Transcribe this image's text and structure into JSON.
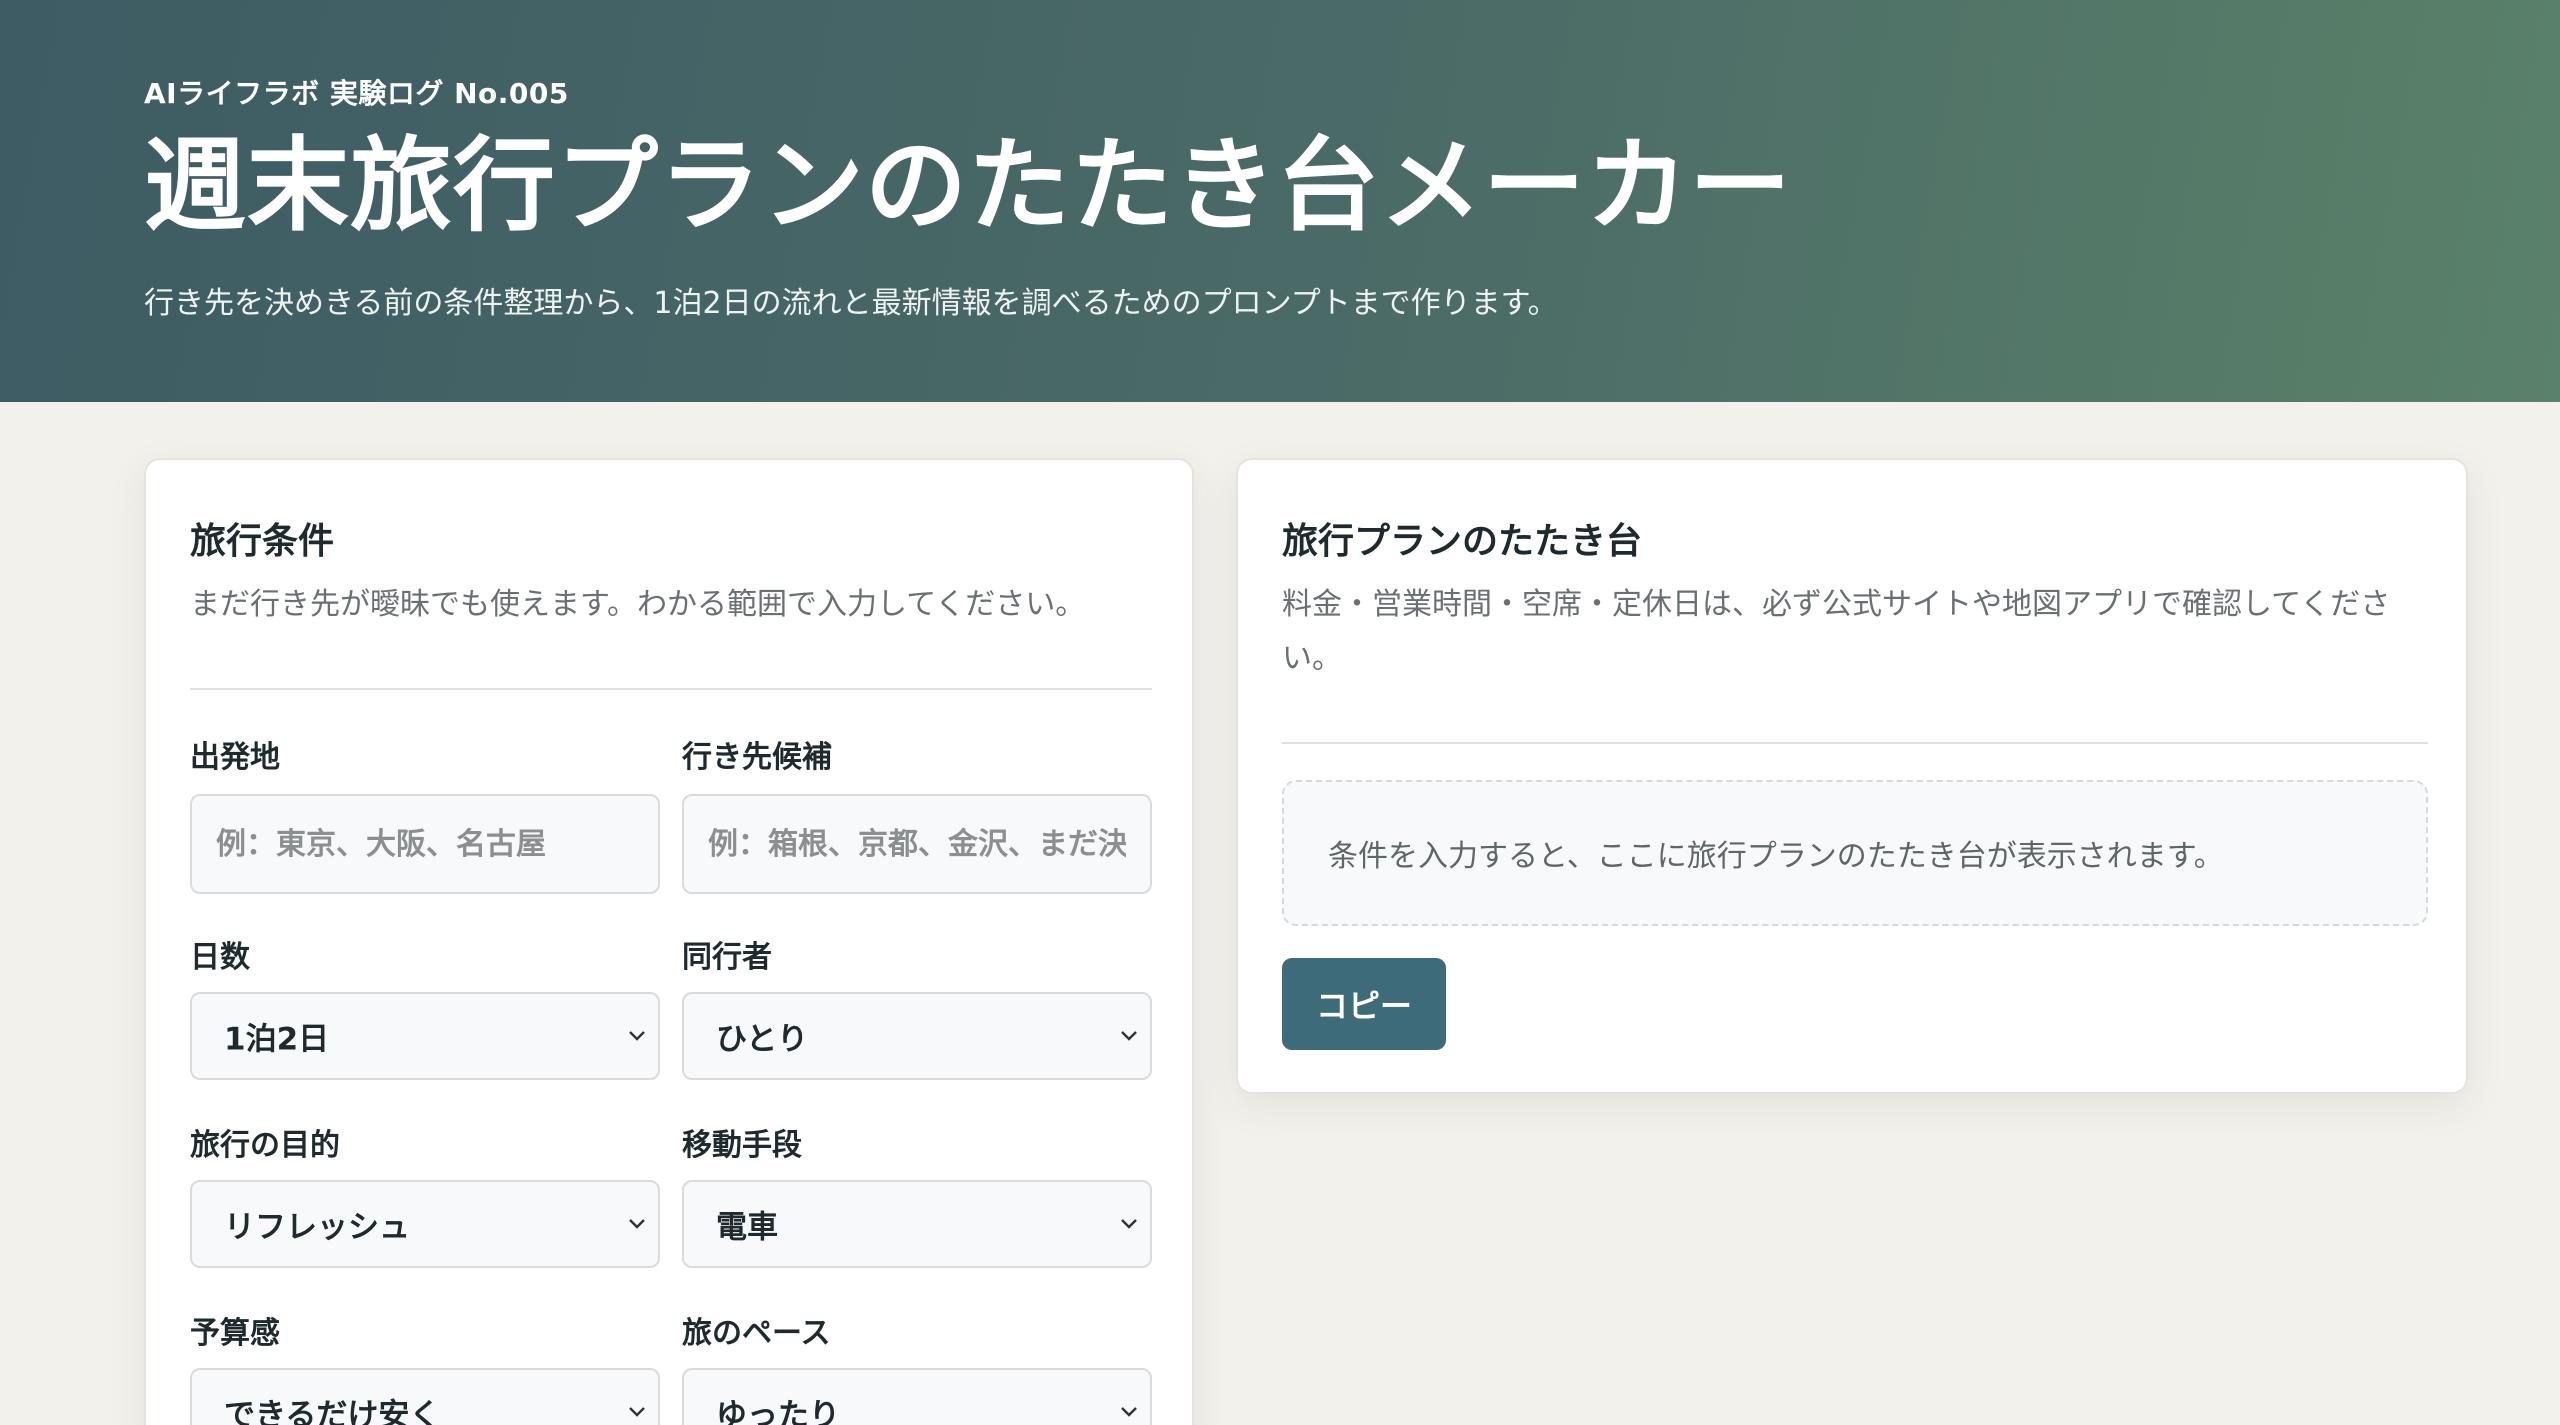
{
  "header": {
    "eyebrow": "AIライフラボ 実験ログ No.005",
    "title": "週末旅行プランのたたき台メーカー",
    "subtitle": "行き先を決めきる前の条件整理から、1泊2日の流れと最新情報を調べるためのプロンプトまで作ります。"
  },
  "conditions": {
    "title": "旅行条件",
    "description": "まだ行き先が曖昧でも使えます。わかる範囲で入力してください。",
    "origin": {
      "label": "出発地",
      "placeholder": "例：東京、大阪、名古屋"
    },
    "destination": {
      "label": "行き先候補",
      "placeholder": "例：箱根、京都、金沢、まだ決めていない"
    },
    "days": {
      "label": "日数",
      "value": "1泊2日"
    },
    "companion": {
      "label": "同行者",
      "value": "ひとり"
    },
    "purpose": {
      "label": "旅行の目的",
      "value": "リフレッシュ"
    },
    "transport": {
      "label": "移動手段",
      "value": "電車"
    },
    "budget": {
      "label": "予算感",
      "value": "できるだけ安く"
    },
    "pace": {
      "label": "旅のペース",
      "value": "ゆったり"
    }
  },
  "plan": {
    "title": "旅行プランのたたき台",
    "description": "料金・営業時間・空席・定休日は、必ず公式サイトや地図アプリで確認してください。",
    "placeholder": "条件を入力すると、ここに旅行プランのたたき台が表示されます。",
    "copy_label": "コピー"
  },
  "icons": {
    "select_arrow": "chevron-down-icon"
  },
  "colors": {
    "header_start": "#3d5c64",
    "header_end": "#5a8169",
    "button": "#3e6b7a",
    "background": "#f3f1ec"
  }
}
